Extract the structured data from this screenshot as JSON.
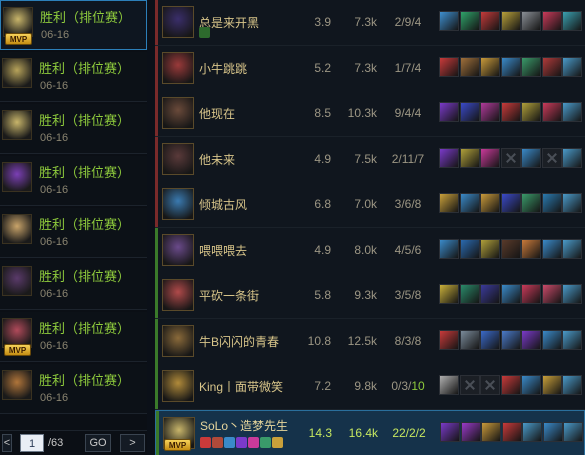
{
  "matches": [
    {
      "result": "胜利（排位赛）",
      "date": "06-16",
      "mvp": "MVP",
      "color": "#c8b56a"
    },
    {
      "result": "胜利（排位赛）",
      "date": "06-16",
      "mvp": "",
      "color": "#b7a35a"
    },
    {
      "result": "胜利（排位赛）",
      "date": "06-16",
      "mvp": "",
      "color": "#c8b56a"
    },
    {
      "result": "胜利（排位赛）",
      "date": "06-16",
      "mvp": "",
      "color": "#7b3fb5"
    },
    {
      "result": "胜利（排位赛）",
      "date": "06-16",
      "mvp": "",
      "color": "#c9a46a"
    },
    {
      "result": "胜利（排位赛）",
      "date": "06-16",
      "mvp": "",
      "color": "#5a3a6a"
    },
    {
      "result": "胜利（排位赛）",
      "date": "06-16",
      "mvp": "MVP",
      "color": "#b04a5a"
    },
    {
      "result": "胜利（排位赛）",
      "date": "06-16",
      "mvp": "",
      "color": "#b0753a"
    }
  ],
  "pager": {
    "current": "1",
    "total": "/63",
    "go": "GO",
    "prev": "<",
    "next": ">"
  },
  "players": [
    {
      "name": "总是来开黑",
      "kda": "3.9",
      "gold": "7.3k",
      "kdadetail": "2/9/4",
      "avatar": "#3a2e6a",
      "team": "#7a2a2a",
      "items": [
        "#3e8fcf",
        "#2fa36a",
        "#c43a3a",
        "#b8a03a",
        "#8a8f96",
        "#c93a5a",
        "#3aa0b0"
      ]
    },
    {
      "name": "小牛跳跳",
      "kda": "5.2",
      "gold": "7.3k",
      "kdadetail": "1/7/4",
      "avatar": "#9a3a3a",
      "team": "#7a2a2a",
      "items": [
        "#c93a3a",
        "#a0703a",
        "#c99a3a",
        "#3a8ac9",
        "#3a9a6a",
        "#b03a3a",
        "#4a9ac9"
      ]
    },
    {
      "name": "他现在",
      "kda": "8.5",
      "gold": "10.3k",
      "kdadetail": "9/4/4",
      "avatar": "#6a4a3a",
      "team": "#7a2a2a",
      "items": [
        "#7a3ac9",
        "#3a4ac9",
        "#b03a9a",
        "#c93a3a",
        "#b0a03a",
        "#c93a5a",
        "#4a9ac9"
      ]
    },
    {
      "name": "他未来",
      "kda": "4.9",
      "gold": "7.5k",
      "kdadetail": "2/11/7",
      "avatar": "#5a3a3a",
      "team": "#7a2a2a",
      "items": [
        "#7a3ac9",
        "#b0a03a",
        "#c93a9a",
        "",
        "#3a8ac9",
        "",
        "#4a9ac9"
      ]
    },
    {
      "name": "倾城古风",
      "kda": "6.8",
      "gold": "7.0k",
      "kdadetail": "3/6/8",
      "avatar": "#3a7ab0",
      "team": "#7a2a2a",
      "items": [
        "#c9a03a",
        "#3a8ac9",
        "#c99a3a",
        "#3a4ac9",
        "#3a9a6a",
        "#2a7ab0",
        "#4a9ac9"
      ]
    },
    {
      "name": "喂喂喂去",
      "kda": "4.9",
      "gold": "8.0k",
      "kdadetail": "4/5/6",
      "avatar": "#6a4a8a",
      "team": "#3a7a2a",
      "items": [
        "#3a8ac9",
        "#2a6ab0",
        "#b0a03a",
        "#5a3a2a",
        "#c97a3a",
        "#3a8ac9",
        "#4a9ac9"
      ]
    },
    {
      "name": "平砍一条街",
      "kda": "5.8",
      "gold": "9.3k",
      "kdadetail": "3/5/8",
      "avatar": "#b04a4a",
      "team": "#3a7a2a",
      "items": [
        "#c9b03a",
        "#2a8a6a",
        "#3a3a9a",
        "#3a8ac9",
        "#c93a5a",
        "#c94a6a",
        "#4a9ac9"
      ]
    },
    {
      "name": "牛B闪闪的青春",
      "kda": "10.8",
      "gold": "12.5k",
      "kdadetail": "8/3/8",
      "avatar": "#8a6a3a",
      "team": "#3a7a2a",
      "items": [
        "#c93a3a",
        "#7a8a9a",
        "#3a6ac9",
        "#4a7ac9",
        "#7a3ac9",
        "#3a8ac9",
        "#4a9ac9"
      ]
    },
    {
      "name": "King丨面带微笑",
      "kda": "7.2",
      "gold": "9.8k",
      "kdadetail": "0/3/",
      "assists": "10",
      "avatar": "#b08a3a",
      "team": "#3a7a2a",
      "items": [
        "#b0b0b0",
        "",
        "",
        "#c93a3a",
        "#3a8ac9",
        "#c9a03a",
        "#4a9ac9"
      ]
    },
    {
      "name": "SoLo丶造梦先生",
      "kda": "14.3",
      "gold": "16.4k",
      "kdadetail": "22/2/2",
      "avatar": "#c8b56a",
      "team": "#3a7a2a",
      "items": [
        "#7a3ac9",
        "#9a3ac9",
        "#c99a3a",
        "#c93a3a",
        "#4a9ac9",
        "#3a8ac9",
        "#4a9ac9"
      ]
    }
  ],
  "me_mvp": "MVP"
}
